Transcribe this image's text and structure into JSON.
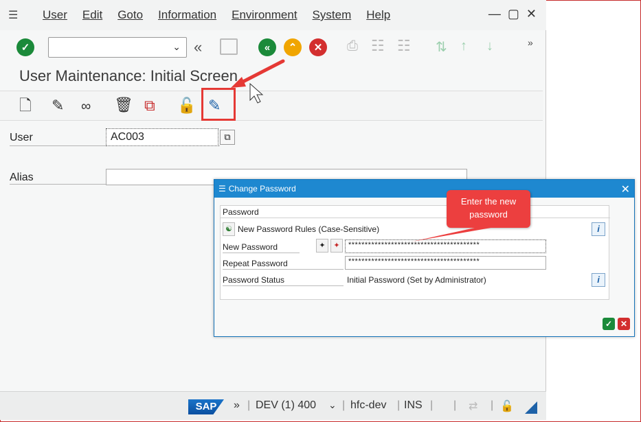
{
  "menubar": {
    "items": [
      "User",
      "Edit",
      "Goto",
      "Information",
      "Environment",
      "System",
      "Help"
    ]
  },
  "toolbar": {
    "command_field_value": ""
  },
  "screen": {
    "title": "User Maintenance: Initial Screen"
  },
  "form": {
    "user_label": "User",
    "user_value": "AC003",
    "alias_label": "Alias",
    "alias_value": ""
  },
  "dialog": {
    "title": "Change Password",
    "group_header": "Password",
    "rules_label": "New Password Rules (Case-Sensitive)",
    "new_password_label": "New Password",
    "new_password_value": "****************************************",
    "repeat_password_label": "Repeat Password",
    "repeat_password_value": "****************************************",
    "status_label": "Password Status",
    "status_value": "Initial Password (Set by Administrator)"
  },
  "callout": {
    "text": "Enter the new password"
  },
  "statusbar": {
    "sap_logo": "SAP",
    "system": "DEV (1) 400",
    "host": "hfc-dev",
    "mode": "INS"
  },
  "colors": {
    "accent": "#1e88d0",
    "highlight": "#e53935",
    "ok_green": "#1b8a3a",
    "cancel_red": "#d32f2f"
  },
  "icons": [
    "menu-icon",
    "check-icon",
    "save-icon",
    "back-icon",
    "exit-icon",
    "cancel-icon",
    "print-icon",
    "find-icon",
    "create-icon",
    "change-icon",
    "display-icon",
    "delete-icon",
    "copy-icon",
    "lock-icon",
    "change-password-icon",
    "info-icon"
  ]
}
